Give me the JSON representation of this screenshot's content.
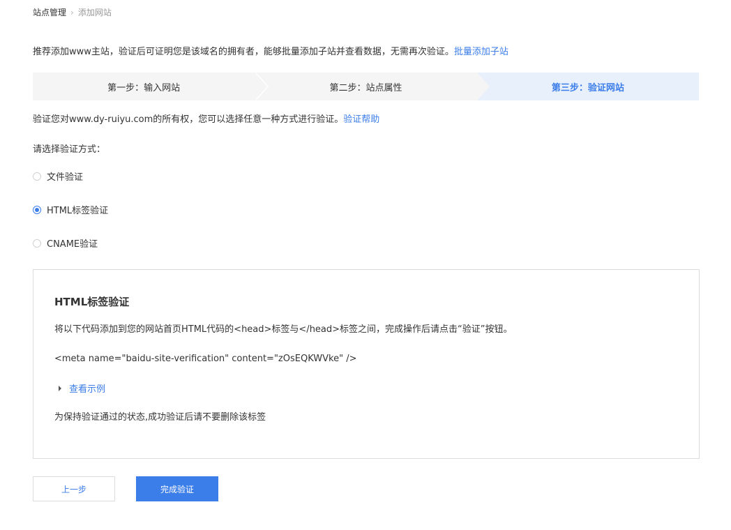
{
  "breadcrumb": {
    "home": "站点管理",
    "separator": "›",
    "current": "添加网站"
  },
  "intro": {
    "text": "推荐添加www主站，验证后可证明您是该域名的拥有者，能够批量添加子站并查看数据，无需再次验证。",
    "link": "批量添加子站"
  },
  "steps": [
    {
      "label": "第一步：输入网站",
      "active": false
    },
    {
      "label": "第二步：站点属性",
      "active": false
    },
    {
      "label": "第三步：验证网站",
      "active": true
    }
  ],
  "verify": {
    "text": "验证您对www.dy-ruiyu.com的所有权，您可以选择任意一种方式进行验证。",
    "help_link": "验证帮助"
  },
  "choose_label": "请选择验证方式：",
  "methods": [
    {
      "label": "文件验证",
      "checked": false
    },
    {
      "label": "HTML标签验证",
      "checked": true
    },
    {
      "label": "CNAME验证",
      "checked": false
    }
  ],
  "panel": {
    "title": "HTML标签验证",
    "instruction": "将以下代码添加到您的网站首页HTML代码的<head>标签与</head>标签之间，完成操作后请点击“验证”按钮。",
    "code": "<meta name=\"baidu-site-verification\" content=\"zOsEQKWVke\" />",
    "example_link": "查看示例",
    "note": "为保持验证通过的状态,成功验证后请不要删除该标签"
  },
  "buttons": {
    "prev": "上一步",
    "done": "完成验证"
  },
  "colors": {
    "accent": "#3b7de9",
    "step_active_bg": "#e8f0fc",
    "step_bg": "#f5f5f5"
  }
}
